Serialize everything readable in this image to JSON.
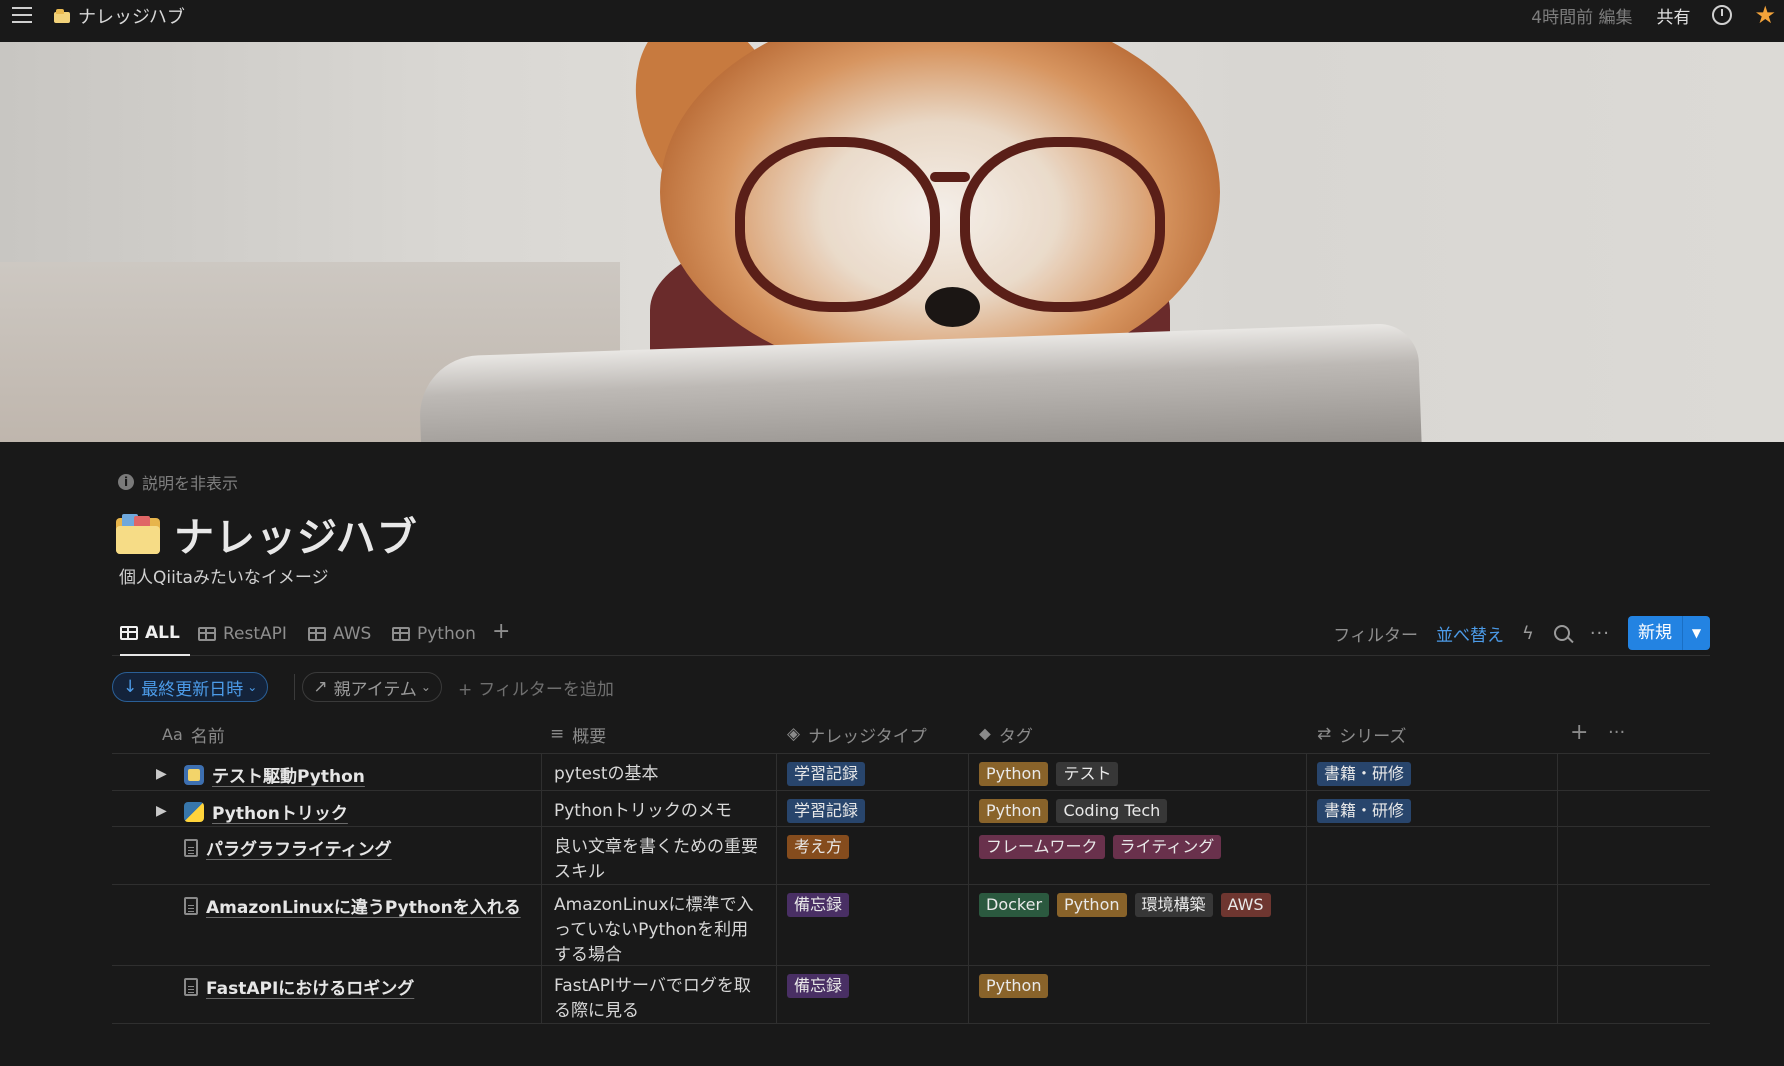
{
  "topbar": {
    "breadcrumb": "ナレッジハブ",
    "edited": "4時間前 編集",
    "share": "共有"
  },
  "page": {
    "hide_description": "説明を非表示",
    "title": "ナレッジハブ",
    "description": "個人Qiitaみたいなイメージ"
  },
  "views": {
    "tabs": [
      {
        "label": "ALL",
        "active": true
      },
      {
        "label": "RestAPI",
        "active": false
      },
      {
        "label": "AWS",
        "active": false
      },
      {
        "label": "Python",
        "active": false
      }
    ],
    "filter": "フィルター",
    "sort": "並べ替え",
    "new": "新規"
  },
  "filters": {
    "sort_pill": "最終更新日時",
    "parent_pill": "親アイテム",
    "add_filter": "フィルターを追加"
  },
  "columns": {
    "name": "名前",
    "summary": "概要",
    "type": "ナレッジタイプ",
    "tags": "タグ",
    "series": "シリーズ"
  },
  "colors": {
    "accent": "#2383e2",
    "tag_blue": "#28456c",
    "tag_orange": "#854c1d",
    "tag_gray": "#373737",
    "tag_purple": "#492f64",
    "tag_brown": "#603b2c",
    "tag_red": "#6e3630",
    "tag_pink": "#69314c",
    "tag_green": "#2b593f",
    "tag_yellow": "#89632a"
  },
  "rows": [
    {
      "name": "テスト駆動Python",
      "icon": "test-app-icon",
      "expandable": true,
      "summary": "pytestの基本",
      "type": {
        "label": "学習記録",
        "color": "#28456c"
      },
      "tags": [
        {
          "label": "Python",
          "color": "#89632a"
        },
        {
          "label": "テスト",
          "color": "#373737"
        }
      ],
      "series": [
        {
          "label": "書籍・研修",
          "color": "#28456c"
        }
      ]
    },
    {
      "name": "Pythonトリック",
      "icon": "python-icon",
      "expandable": true,
      "summary": "Pythonトリックのメモ",
      "type": {
        "label": "学習記録",
        "color": "#28456c"
      },
      "tags": [
        {
          "label": "Python",
          "color": "#89632a"
        },
        {
          "label": "Coding Tech",
          "color": "#373737"
        }
      ],
      "series": [
        {
          "label": "書籍・研修",
          "color": "#28456c"
        }
      ]
    },
    {
      "name": "パラグラフライティング",
      "icon": "document-icon",
      "expandable": false,
      "summary": "良い文章を書くための重要スキル",
      "type": {
        "label": "考え方",
        "color": "#854c1d"
      },
      "tags": [
        {
          "label": "フレームワーク",
          "color": "#69314c"
        },
        {
          "label": "ライティング",
          "color": "#69314c"
        }
      ],
      "series": []
    },
    {
      "name": "AmazonLinuxに違うPythonを入れる",
      "icon": "document-icon",
      "expandable": false,
      "summary": "AmazonLinuxに標準で入っていないPythonを利用する場合",
      "type": {
        "label": "備忘録",
        "color": "#492f64"
      },
      "tags": [
        {
          "label": "Docker",
          "color": "#2b593f"
        },
        {
          "label": "Python",
          "color": "#89632a"
        },
        {
          "label": "環境構築",
          "color": "#373737"
        },
        {
          "label": "AWS",
          "color": "#6e3630"
        }
      ],
      "series": []
    },
    {
      "name": "FastAPIにおけるロギング",
      "icon": "document-icon",
      "expandable": false,
      "summary": "FastAPIサーバでログを取る際に見る",
      "type": {
        "label": "備忘録",
        "color": "#492f64"
      },
      "tags": [
        {
          "label": "Python",
          "color": "#89632a"
        }
      ],
      "series": []
    }
  ]
}
